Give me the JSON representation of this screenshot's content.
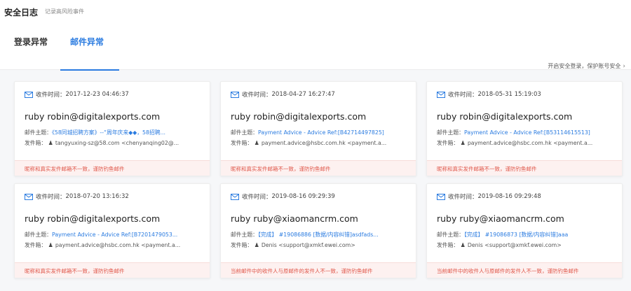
{
  "page": {
    "title": "安全日志",
    "subtitle": "记录高风险事件"
  },
  "tabs": [
    {
      "label": "登录异常",
      "active": false
    },
    {
      "label": "邮件异常",
      "active": true
    }
  ],
  "secure_link": "开启安全登录，保护账号安全",
  "labels": {
    "time_prefix": "收件时间：",
    "subject_prefix": "邮件主题：",
    "from_prefix": "发件箱："
  },
  "colors": {
    "accent": "#2a7be0",
    "warn_text": "#e0574a",
    "warn_bg": "#fdf1f0"
  },
  "cards": [
    {
      "time": "2017-12-23 04:46:37",
      "sender": "ruby robin@digitalexports.com",
      "subject": "《58同城招聘方案》--“周年庆来◆◆，58招聘...",
      "from": "tangyuxing-sz@58.com <chenyanqing02@...",
      "warning": "昵称和真实发件邮箱不一致，谨防钓鱼邮件"
    },
    {
      "time": "2018-04-27 16:27:47",
      "sender": "ruby robin@digitalexports.com",
      "subject": "Payment Advice - Advice Ref:[B42714497825]",
      "from": "payment.advice@hsbc.com.hk <payment.a...",
      "warning": "昵称和真实发件邮箱不一致，谨防钓鱼邮件"
    },
    {
      "time": "2018-05-31 15:19:03",
      "sender": "ruby robin@digitalexports.com",
      "subject": "Payment Advice - Advice Ref:[B53114615513]",
      "from": "payment.advice@hsbc.com.hk <payment.a...",
      "warning": "昵称和真实发件邮箱不一致，谨防钓鱼邮件"
    },
    {
      "time": "2018-07-20 13:16:32",
      "sender": "ruby robin@digitalexports.com",
      "subject": "Payment Advice - Advice Ref:[B7201479053...",
      "from": "payment.advice@hsbc.com.hk <payment.a...",
      "warning": "昵称和真实发件邮箱不一致，谨防钓鱼邮件"
    },
    {
      "time": "2019-08-16 09:29:39",
      "sender": "ruby ruby@xiaomancrm.com",
      "subject": "【完成】 #19086886 [数据/内容纠错]asdfads...",
      "from": "Denis <support@xmkf.ewei.com>",
      "warning": "当前邮件中的收件人与原邮件的发件人不一致，谨防钓鱼邮件"
    },
    {
      "time": "2019-08-16 09:29:48",
      "sender": "ruby ruby@xiaomancrm.com",
      "subject": "【完成】 #19086873 [数据/内容纠错]aaa",
      "from": "Denis <support@xmkf.ewei.com>",
      "warning": "当前邮件中的收件人与原邮件的发件人不一致，谨防钓鱼邮件"
    }
  ]
}
